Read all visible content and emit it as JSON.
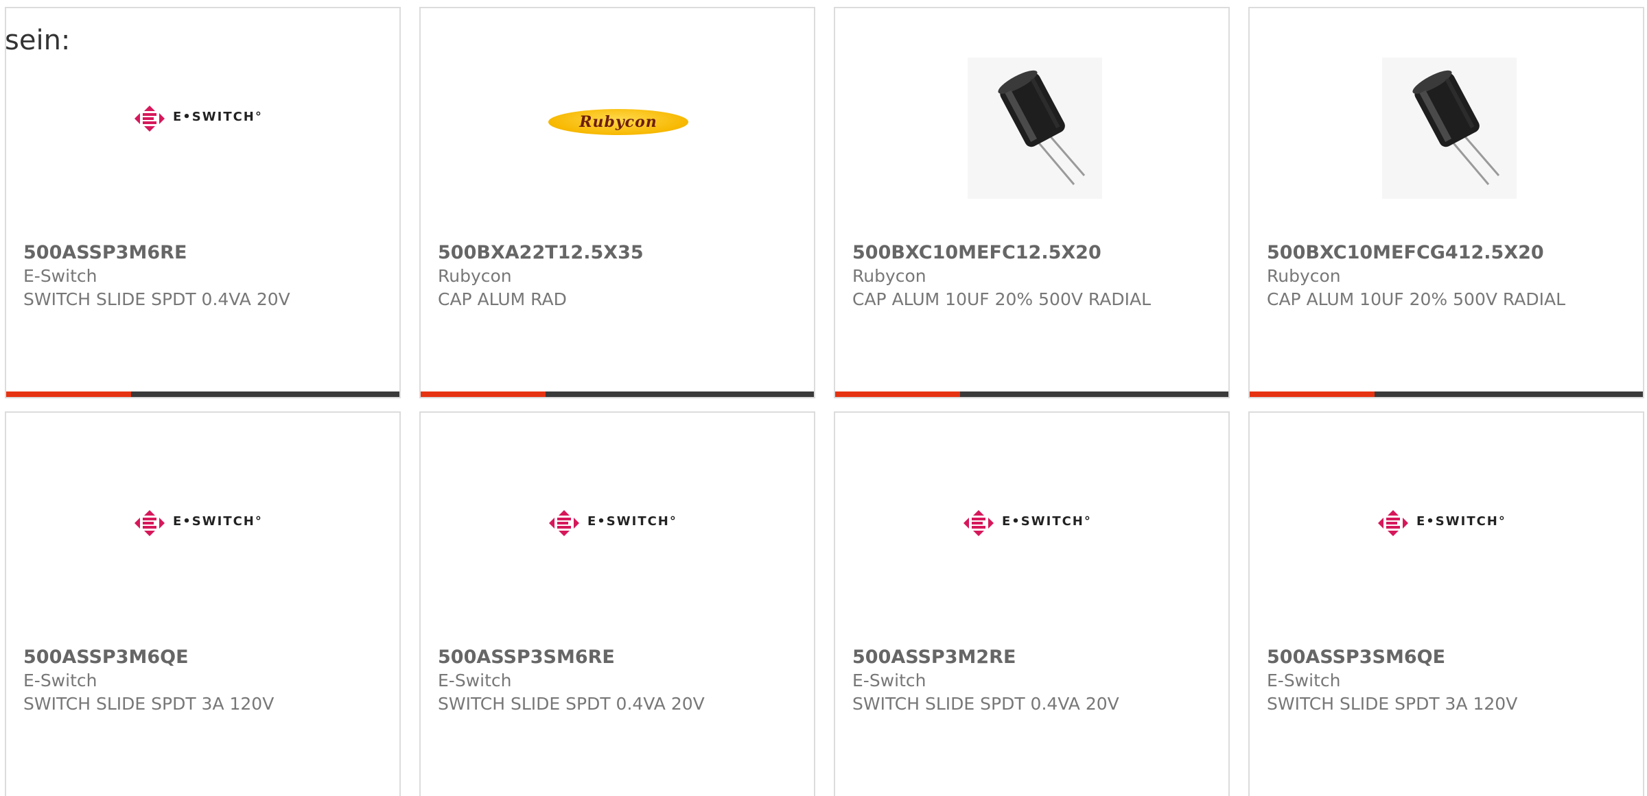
{
  "heading": "sein:",
  "products": [
    {
      "part_number": "500ASSP3M6RE",
      "manufacturer": "E-Switch",
      "description": "SWITCH SLIDE SPDT 0.4VA 20V",
      "logo_text": "E•SWITCH°"
    },
    {
      "part_number": "500BXA22T12.5X35",
      "manufacturer": "Rubycon",
      "description": "CAP ALUM RAD",
      "logo_text": "Rubycon"
    },
    {
      "part_number": "500BXC10MEFC12.5X20",
      "manufacturer": "Rubycon",
      "description": "CAP ALUM 10UF 20% 500V RADIAL"
    },
    {
      "part_number": "500BXC10MEFCG412.5X20",
      "manufacturer": "Rubycon",
      "description": "CAP ALUM 10UF 20% 500V RADIAL"
    },
    {
      "part_number": "500ASSP3M6QE",
      "manufacturer": "E-Switch",
      "description": "SWITCH SLIDE SPDT 3A 120V",
      "logo_text": "E•SWITCH°"
    },
    {
      "part_number": "500ASSP3SM6RE",
      "manufacturer": "E-Switch",
      "description": "SWITCH SLIDE SPDT 0.4VA 20V",
      "logo_text": "E•SWITCH°"
    },
    {
      "part_number": "500ASSP3M2RE",
      "manufacturer": "E-Switch",
      "description": "SWITCH SLIDE SPDT 0.4VA 20V",
      "logo_text": "E•SWITCH°"
    },
    {
      "part_number": "500ASSP3SM6QE",
      "manufacturer": "E-Switch",
      "description": "SWITCH SLIDE SPDT 3A 120V",
      "logo_text": "E•SWITCH°"
    }
  ],
  "colors": {
    "accent": "#e63312",
    "bar": "#3a3a3a",
    "eswitch_brand": "#d6185b",
    "rubycon_brand": "#f7b800"
  },
  "icons": {
    "eswitch": "eswitch-logo-icon",
    "rubycon": "rubycon-logo-icon",
    "capacitor": "capacitor-image-icon"
  }
}
